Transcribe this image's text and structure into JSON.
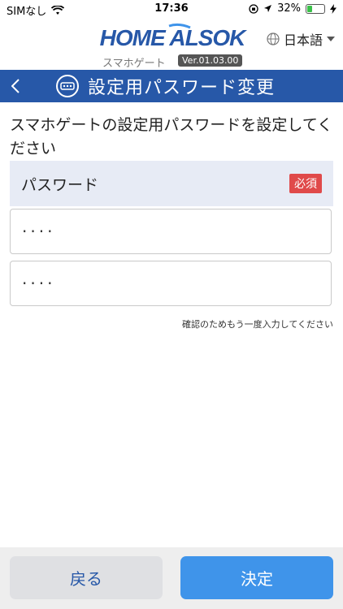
{
  "status_bar": {
    "carrier": "SIMなし",
    "time": "17:36",
    "battery_percent": "32%",
    "battery_level": 0.32
  },
  "header": {
    "logo_text": "HOME ALSOK",
    "subtitle": "スマホゲート",
    "version": "Ver.01.03.00",
    "language": "日本語"
  },
  "titlebar": {
    "title": "設定用パスワード変更"
  },
  "form": {
    "description": "スマホゲートの設定用パスワードを設定してください",
    "field_label": "パスワード",
    "required_badge": "必須",
    "password_value": "····",
    "confirm_value": "····",
    "confirm_hint": "確認のためもう一度入力してください"
  },
  "footer": {
    "back_label": "戻る",
    "ok_label": "決定"
  },
  "colors": {
    "brand": "#2758a8",
    "accent": "#3f94ea",
    "required": "#e04a4a"
  }
}
